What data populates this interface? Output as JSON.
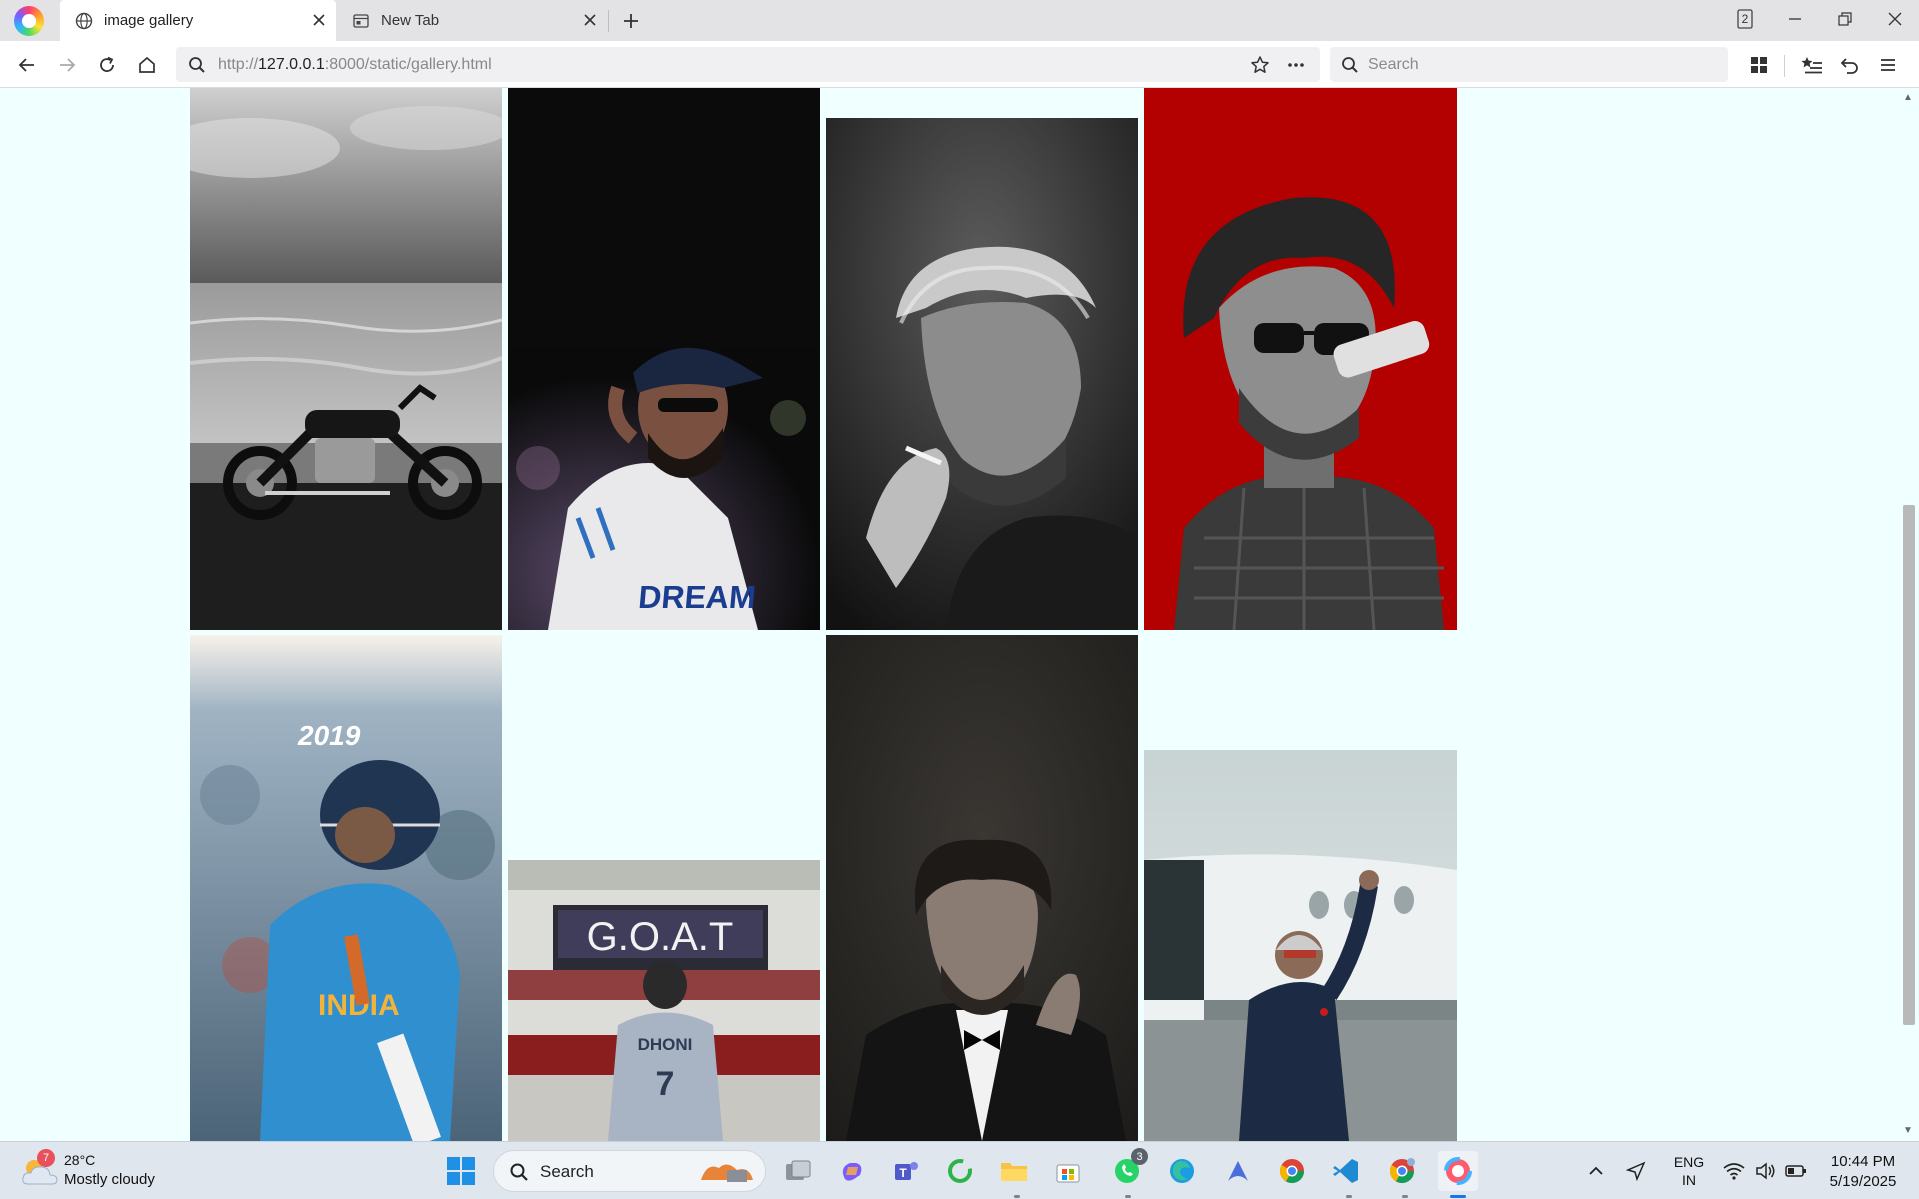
{
  "browser": {
    "tabs": [
      {
        "title": "image gallery",
        "active": true,
        "icon": "globe-icon"
      },
      {
        "title": "New Tab",
        "active": false,
        "icon": "newtab-icon"
      }
    ],
    "tab_count": "2",
    "url": {
      "prefix": "http://",
      "host": "127.0.0.1",
      "rest": ":8000/static/gallery.html"
    },
    "search_placeholder": "Search"
  },
  "gallery": {
    "images": [
      {
        "name": "motorcycle-by-sea-photo",
        "style": "bw"
      },
      {
        "name": "cricketer-cap-photo",
        "style": "dark"
      },
      {
        "name": "smoking-man-portrait",
        "style": "bw"
      },
      {
        "name": "illustrated-man-red-background",
        "style": "red"
      },
      {
        "name": "cricketer-2019-photo",
        "overlay_text": "2019",
        "jersey_text": "INDIA"
      },
      {
        "name": "goat-dhoni-photo",
        "sign_text": "G.O.A.T",
        "jersey_text": "DHONI",
        "number": "7"
      },
      {
        "name": "man-in-tuxedo-portrait",
        "style": "dark"
      },
      {
        "name": "man-waving-by-plane-photo",
        "style": "muted"
      }
    ]
  },
  "taskbar": {
    "weather": {
      "temp": "28°C",
      "condition": "Mostly cloudy",
      "badge": "7"
    },
    "search_label": "Search",
    "whatsapp_badge": "3",
    "language": {
      "line1": "ENG",
      "line2": "IN"
    },
    "time": "10:44 PM",
    "date": "5/19/2025"
  },
  "colors": {
    "page_bg": "#f0ffff",
    "accent_red": "#b30000"
  }
}
